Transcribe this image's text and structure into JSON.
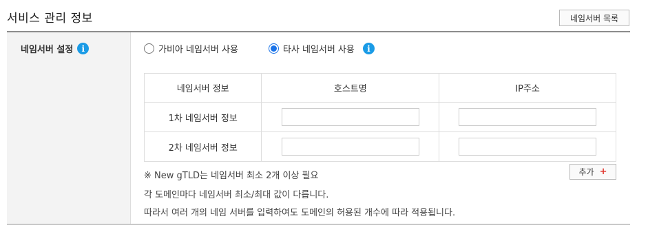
{
  "header": {
    "title": "서비스 관리 정보",
    "ns_list_button": "네임서버 목록"
  },
  "side": {
    "label": "네임서버 설정",
    "info_icon": "i"
  },
  "radio": {
    "option1": "가비아 네임서버 사용",
    "option2": "타사 네임서버 사용",
    "selected": "option2"
  },
  "table": {
    "headers": [
      "네임서버 정보",
      "호스트명",
      "IP주소"
    ],
    "rows": [
      {
        "label": "1차 네임서버 정보",
        "host": "",
        "ip": ""
      },
      {
        "label": "2차 네임서버 정보",
        "host": "",
        "ip": ""
      }
    ]
  },
  "notes": {
    "note1": "※ New gTLD는 네임서버 최소 2개 이상 필요",
    "note2": "각 도메인마다 네임서버 최소/최대 값이 다릅니다.",
    "note3": "따라서 여러 개의 네임 서버를 입력하여도 도메인의 허용된 개수에 따라 적용됩니다."
  },
  "add_button": {
    "label": "추가",
    "icon": "+"
  }
}
